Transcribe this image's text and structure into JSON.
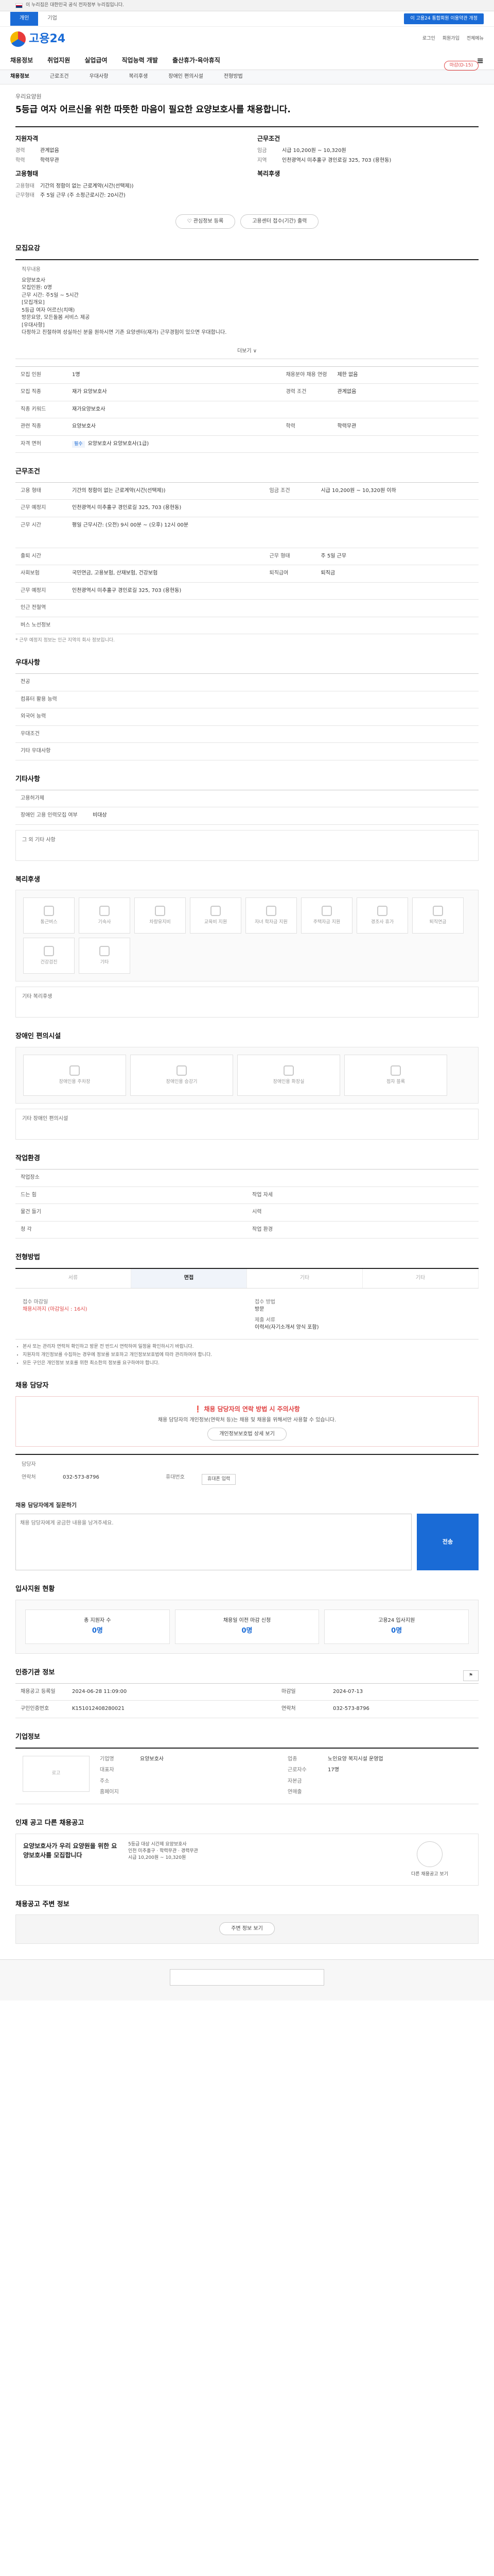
{
  "gov_banner": {
    "text": "이 누리집은 대한민국 공식 전자정부 누리집입니다."
  },
  "site_tabs": [
    "개인",
    "기업"
  ],
  "top_right": "이 고용24 통합회원 이용약관 개정",
  "logo": "고용24",
  "header_icons": [
    "로그인",
    "회원가입",
    "전체메뉴"
  ],
  "nav": [
    "채용정보",
    "취업지원",
    "실업급여",
    "직업능력 개발",
    "출산휴가·육아휴직"
  ],
  "breadcrumb": [
    "채용정보",
    "근로조건",
    "우대사항",
    "복리후생",
    "장애인 편의시설",
    "전형방법"
  ],
  "job": {
    "company": "우리요양원",
    "badge": "마감(D-15)",
    "title": "5등급 여자 어르신을 위한 따뜻한 마음이 필요한 요양보호사를 채용합니다.",
    "req_head": "지원자격",
    "req": [
      [
        "경력",
        "관계없음"
      ],
      [
        "학력",
        "학력무관"
      ]
    ],
    "cond_head": "근무조건",
    "cond": [
      [
        "임금",
        "시급 10,200원 ~ 10,320원"
      ],
      [
        "지역",
        "인천광역시 미추홀구 경인로길 325, 703 (용현동)"
      ]
    ],
    "emp_head": "고용형태",
    "emp": [
      [
        "고용형태",
        "기간의 정함이 없는 근로계약(시간(선택제))"
      ],
      [
        "근무형태",
        "주 5일 근무 (주 소정근로시간: 20시간)"
      ]
    ],
    "welf_head": "복리후생",
    "btn_scrap": "관심정보 등록",
    "btn_cert": "고용센터 접수(기간) 출력"
  },
  "sections": {
    "recruit": "모집요강",
    "jobdesc_label": "직무내용",
    "jobdesc": [
      "요양보호사",
      "모집인원: 0명",
      "근무 시간: 주5일 ~ 5시간",
      "[모집개요]",
      "5등급 여자 어르신(치매)",
      "방문요양, 모든돌봄 서비스 제공",
      "[우대사항]",
      "다정하고 친절하며 성실하신 분을 원하시면 기존 요양센터(재가) 근무경험이 있으면 우대합니다."
    ],
    "more": "더보기",
    "recruit_rows": [
      [
        "모집 인원",
        "1명",
        "채용분야 채용 연령",
        "제한 없음"
      ],
      [
        "모집 직종",
        "재가 요양보호사",
        "경력 조건",
        "관계없음"
      ],
      [
        "직종 키워드",
        "재가요양보호사",
        "",
        ""
      ],
      [
        "관련 직종",
        "요양보호사",
        "학력",
        "학력무관"
      ],
      [
        "자격 면허",
        "요양보호사 요양보호사(1급)",
        "",
        ""
      ]
    ],
    "cond_title": "근무조건",
    "cond_rows": [
      [
        "고용 형태",
        "기간의 정함이 없는 근로계약(시간(선택제))",
        "임금 조건",
        "시급 10,200원 ~ 10,320원 이하"
      ],
      [
        "근무 예정지",
        "인천광역시 미추홀구 경인로길 325, 703 (용현동)",
        "",
        ""
      ],
      [
        "근무 시간",
        "평일 근무시간: (오전) 9시 00분 ~ (오후) 12시 00분",
        "",
        ""
      ],
      [
        "출퇴 시간",
        "",
        "근무 형태",
        "주 5일 근무"
      ],
      [
        "사회보험",
        "국민연금, 고용보험, 산재보험, 건강보험",
        "퇴직급여",
        "퇴직금"
      ],
      [
        "근무 예정지",
        "인천광역시 미추홀구 경인로길 325, 703 (용현동)",
        "",
        ""
      ],
      [
        "인근 전철역",
        "",
        "",
        ""
      ],
      [
        "버스 노선정보",
        "",
        "",
        ""
      ]
    ],
    "cond_note": "* 근무 예정지 정보는 인근 지역의 회사 정보입니다.",
    "pref_title": "우대사항",
    "pref_rows": [
      [
        "전공",
        ""
      ],
      [
        "컴퓨터 활용 능력",
        ""
      ],
      [
        "외국어 능력",
        ""
      ],
      [
        "우대조건",
        ""
      ],
      [
        "기타 우대사항",
        ""
      ]
    ],
    "etc_title": "기타사항",
    "etc_rows": [
      [
        "고용허가제",
        ""
      ],
      [
        "장애인 고용 인력모집 여부",
        "비대상"
      ]
    ],
    "etc_other": "그 외 기타 사항",
    "welf_title": "복리후생",
    "welf_icons": [
      "통근버스",
      "기숙사",
      "차량유지비",
      "교육비 지원",
      "자녀 학자금 지원",
      "주택자금 지원",
      "경조사 휴가",
      "퇴직연금",
      "건강검진",
      "기타"
    ],
    "welf_other": "기타 복리후생",
    "fac_title": "장애인 편의시설",
    "fac_icons": [
      "장애인용 주차장",
      "장애인용 승강기",
      "장애인용 화장실",
      "점자 블록"
    ],
    "fac_other": "기타 장애인 편의시설",
    "work_title": "작업환경",
    "work_rows": [
      [
        "작업장소",
        "",
        "",
        ""
      ],
      [
        "드는 힘",
        "",
        "작업 자세",
        ""
      ],
      [
        "물건 들기",
        "",
        "시력",
        ""
      ],
      [
        "청 각",
        "",
        "작업 환경",
        ""
      ]
    ],
    "sel_title": "전형방법",
    "sel_steps": [
      "서류",
      "면접",
      "기타",
      "기타"
    ],
    "apply_l": [
      "접수 마감일",
      "채용시까지 (마감일시 : 16시)"
    ],
    "apply_r": [
      "접수 방법",
      "방문",
      "제출 서류",
      "이력서(자기소개서 양식 포함)"
    ],
    "sel_notes": [
      "본사 또는 관리자 연락처 확인하고 방문 전 반드시 연락하여 일정을 확인하시기 바랍니다.",
      "지원자의 개인정보를 수집하는 경우에 정보를 보호하고 개인정보보호법에 따라 관리하여야 합니다.",
      "모든 구인은 개인정보 보호를 위한 최소한의 정보를 요구하여야 합니다."
    ],
    "mgr_title": "채용 담당자",
    "alert_t": "채용 담당자의 연락 방법 시 주의사항",
    "alert_s": "채용 담당자의 개인정보(연락처 등)는 채용 및 채용을 위해서만 사용할 수 있습니다.",
    "alert_btn": "개인정보보호법 상세 보기",
    "mgr_rows": [
      [
        "담당자",
        ""
      ],
      [
        "연락처",
        "032-573-8796",
        "휴대번호",
        "휴대폰 입력"
      ]
    ],
    "q_title": "채용 담당자에게 질문하기",
    "q_ph": "채용 담당자에게 궁금한 내용을 남겨주세요.",
    "q_send": "전송",
    "status_title": "입사지원 현황",
    "stats": [
      [
        "총 지원자 수",
        "0명"
      ],
      [
        "채용일 이전 마감 신청",
        "0명"
      ],
      [
        "고용24 입사지원",
        "0명"
      ]
    ],
    "reg_title": "인증기관 정보",
    "reg_rows": [
      [
        "채용공고 등록일",
        "2024-06-28 11:09:00",
        "마감일",
        "2024-07-13"
      ],
      [
        "구인인증번호",
        "K151012408280021",
        "연락처",
        "032-573-8796"
      ]
    ],
    "co_title": "기업정보",
    "co_logo": "로고",
    "co_rows": [
      [
        "기업명",
        "요양보호사",
        "업종",
        "노인요양 복지시설 운영업"
      ],
      [
        "대표자",
        "",
        "근로자수",
        "17명"
      ],
      [
        "주소",
        "",
        "자본금",
        ""
      ],
      [
        "홈페이지",
        "",
        "연매출",
        ""
      ]
    ],
    "reco_title": "인재 공고 다른 채용공고",
    "reco_l": "요양보호사가 우리 요양원을 위한 요양보호사를 모집합니다",
    "reco_m": [
      "5등급 대상 시간제 요양보호사",
      "인천 미추홀구 · 학력무관 · 경력무관",
      "시급 10,200원 ~ 10,320원"
    ],
    "reco_r": "다른 채용공고 보기",
    "nearby_title": "채용공고 주변 정보",
    "nearby": "주변 정보 보기"
  }
}
